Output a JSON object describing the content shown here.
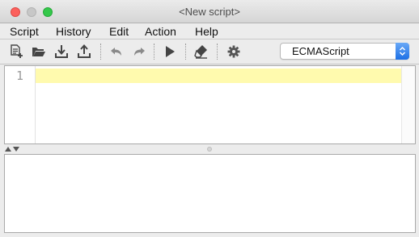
{
  "window": {
    "title": "<New script>"
  },
  "menubar": {
    "items": [
      {
        "label": "Script"
      },
      {
        "label": "History"
      },
      {
        "label": "Edit"
      },
      {
        "label": "Action"
      },
      {
        "label": "Help"
      }
    ]
  },
  "toolbar": {
    "buttons": [
      {
        "icon": "new-script-icon"
      },
      {
        "icon": "open-folder-icon"
      },
      {
        "icon": "download-icon"
      },
      {
        "icon": "upload-icon"
      },
      {
        "icon": "undo-icon"
      },
      {
        "icon": "redo-icon"
      },
      {
        "icon": "run-icon"
      },
      {
        "icon": "eraser-icon"
      },
      {
        "icon": "gear-icon"
      }
    ],
    "language": {
      "selected": "ECMAScript"
    }
  },
  "editor": {
    "line_numbers": [
      "1"
    ],
    "highlight_color": "#fffaae"
  },
  "colors": {
    "close": "#fc605c",
    "minimize": "#c7c7c7",
    "maximize": "#34c84a",
    "select_accent": "#1c6fe5"
  }
}
